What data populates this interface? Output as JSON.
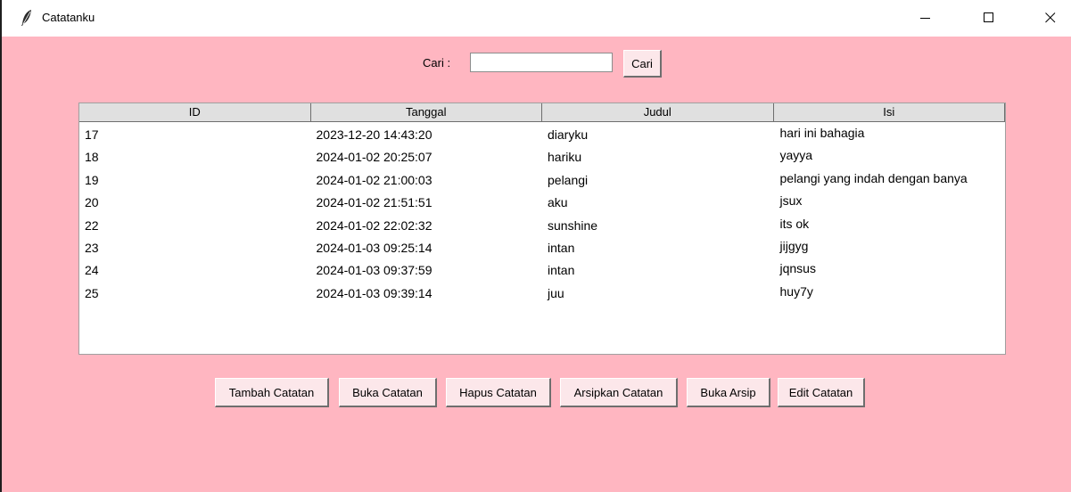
{
  "window": {
    "title": "Catatanku",
    "icon": "feather-icon",
    "controls": [
      "minimize-icon",
      "maximize-icon",
      "close-icon"
    ]
  },
  "search": {
    "label": "Cari :",
    "value": "",
    "placeholder": "",
    "button_label": "Cari"
  },
  "table": {
    "columns": [
      "ID",
      "Tanggal",
      "Judul",
      "Isi"
    ],
    "rows": [
      {
        "id": "17",
        "tanggal": "2023-12-20 14:43:20",
        "judul": "diaryku",
        "isi": "hari ini bahagia"
      },
      {
        "id": "18",
        "tanggal": "2024-01-02 20:25:07",
        "judul": "hariku",
        "isi": "yayya"
      },
      {
        "id": "19",
        "tanggal": "2024-01-02 21:00:03",
        "judul": "pelangi",
        "isi": "pelangi yang indah dengan banya"
      },
      {
        "id": "20",
        "tanggal": "2024-01-02 21:51:51",
        "judul": "aku",
        "isi": "jsux"
      },
      {
        "id": "22",
        "tanggal": "2024-01-02 22:02:32",
        "judul": "sunshine",
        "isi": "its ok"
      },
      {
        "id": "23",
        "tanggal": "2024-01-03 09:25:14",
        "judul": "intan",
        "isi": "jijgyg"
      },
      {
        "id": "24",
        "tanggal": "2024-01-03 09:37:59",
        "judul": "intan",
        "isi": "jqnsus"
      },
      {
        "id": "25",
        "tanggal": "2024-01-03 09:39:14",
        "judul": "juu",
        "isi": "huy7y"
      }
    ]
  },
  "actions": {
    "tambah": "Tambah Catatan",
    "buka": "Buka Catatan",
    "hapus": "Hapus Catatan",
    "arsipkan": "Arsipkan Catatan",
    "buka_arsip": "Buka Arsip",
    "edit": "Edit Catatan"
  },
  "colors": {
    "background": "#ffb6c1",
    "button": "#fce7ea",
    "header": "#e0e0e0"
  }
}
